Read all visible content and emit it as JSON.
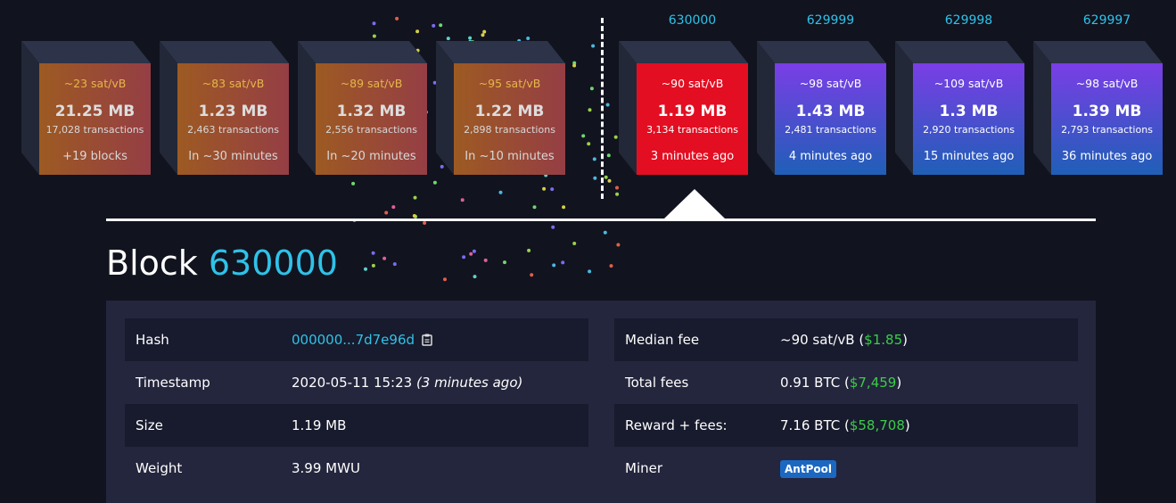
{
  "mempool_blocks": [
    {
      "fee": "~23 sat/vB",
      "size": "21.25 MB",
      "tx": "17,028 transactions",
      "when": "+19 blocks"
    },
    {
      "fee": "~83 sat/vB",
      "size": "1.23 MB",
      "tx": "2,463 transactions",
      "when": "In ~30 minutes"
    },
    {
      "fee": "~89 sat/vB",
      "size": "1.32 MB",
      "tx": "2,556 transactions",
      "when": "In ~20 minutes"
    },
    {
      "fee": "~95 sat/vB",
      "size": "1.22 MB",
      "tx": "2,898 transactions",
      "when": "In ~10 minutes"
    }
  ],
  "chain_blocks": [
    {
      "height": "630000",
      "fee": "~90 sat/vB",
      "size": "1.19 MB",
      "tx": "3,134 transactions",
      "when": "3 minutes ago",
      "color": "#e30e22"
    },
    {
      "height": "629999",
      "fee": "~98 sat/vB",
      "size": "1.43 MB",
      "tx": "2,481 transactions",
      "when": "4 minutes ago",
      "color": "#7a3ee6"
    },
    {
      "height": "629998",
      "fee": "~109 sat/vB",
      "size": "1.3 MB",
      "tx": "2,920 transactions",
      "when": "15 minutes ago",
      "color": "#7a3ee6"
    },
    {
      "height": "629997",
      "fee": "~98 sat/vB",
      "size": "1.39 MB",
      "tx": "2,793 transactions",
      "when": "36 minutes ago",
      "color": "#7a3ee6"
    }
  ],
  "block": {
    "title_word": "Block",
    "title_number": "630000"
  },
  "details": {
    "hash_label": "Hash",
    "hash_value": "000000...7d7e96d",
    "timestamp_label": "Timestamp",
    "timestamp_value": "2020-05-11 15:23",
    "timestamp_relative": "(3 minutes ago)",
    "size_label": "Size",
    "size_value": "1.19 MB",
    "weight_label": "Weight",
    "weight_value": "3.99 MWU",
    "median_fee_label": "Median fee",
    "median_fee_btc": "~90 sat/vB",
    "median_fee_usd": "$1.85",
    "total_fees_label": "Total fees",
    "total_fees_btc": "0.91 BTC",
    "total_fees_usd": "$7,459",
    "reward_label": "Reward + fees:",
    "reward_btc": "7.16 BTC",
    "reward_usd": "$58,708",
    "miner_label": "Miner",
    "miner_value": "AntPool"
  },
  "colors": {
    "accent": "#2fc2e8",
    "fiat": "#3bcc49",
    "background": "#11131f",
    "panel": "#24263d"
  },
  "icons": {
    "copy": "clipboard-icon",
    "selected_block": "triangle-pointer-icon"
  }
}
